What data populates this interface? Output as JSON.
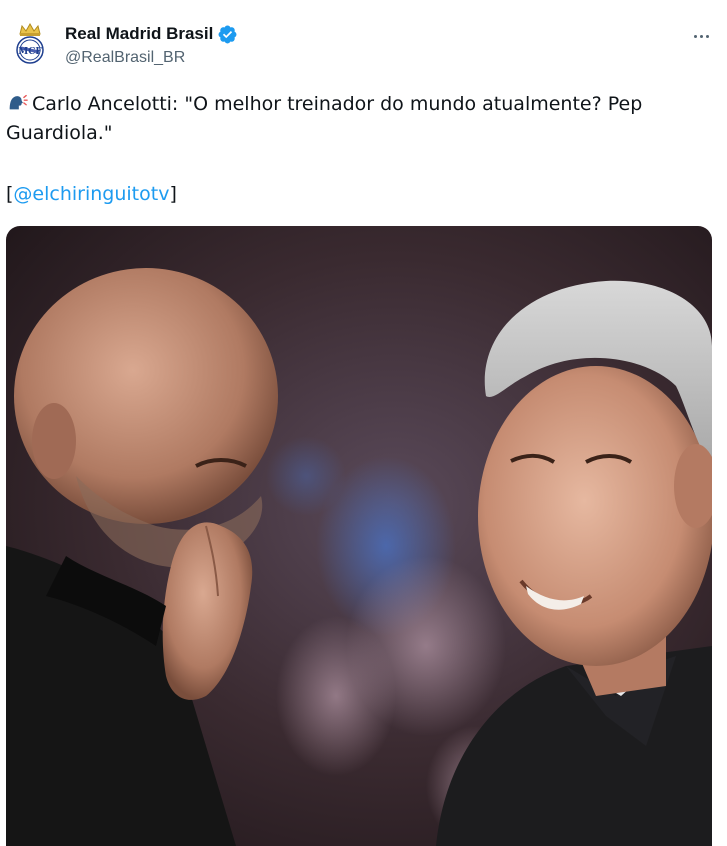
{
  "account": {
    "display_name": "Real Madrid Brasil",
    "handle": "@RealBrasil_BR",
    "verified": true
  },
  "icons": {
    "avatar": "real-madrid-crest-icon",
    "verified": "verified-badge-icon",
    "speaker": "speaking-head-icon",
    "more": "more-options-icon"
  },
  "tweet": {
    "text": "Carlo Ancelotti: \"O melhor treinador do mundo atualmente? Pep Guardiola.\"",
    "mention_prefix": "[",
    "mention": "@elchiringuitotv",
    "mention_suffix": "]"
  },
  "media": {
    "type": "photo",
    "description_icon": "photo-two-coaches"
  },
  "colors": {
    "link": "#1d9bf0",
    "verified": "#1d9bf0",
    "secondary_text": "#536471",
    "primary_text": "#0f1419"
  }
}
